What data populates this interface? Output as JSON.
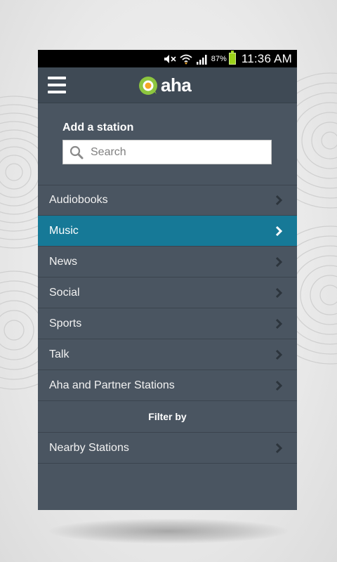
{
  "status_bar": {
    "battery_percent": "87%",
    "time": "11:36 AM",
    "icons": [
      "mute-icon",
      "wifi-icon",
      "signal-icon",
      "battery-icon"
    ]
  },
  "header": {
    "logo_text": "aha",
    "menu_icon": "hamburger-menu-icon"
  },
  "add_station": {
    "title": "Add a station",
    "search_placeholder": "Search"
  },
  "categories": [
    {
      "label": "Audiobooks",
      "selected": false
    },
    {
      "label": "Music",
      "selected": true
    },
    {
      "label": "News",
      "selected": false
    },
    {
      "label": "Social",
      "selected": false
    },
    {
      "label": "Sports",
      "selected": false
    },
    {
      "label": "Talk",
      "selected": false
    },
    {
      "label": "Aha and Partner Stations",
      "selected": false
    }
  ],
  "filter": {
    "header": "Filter by",
    "items": [
      {
        "label": "Nearby Stations"
      }
    ]
  },
  "colors": {
    "panel_bg": "#4a5561",
    "header_bg": "#3f4a55",
    "selected_bg": "#167997",
    "logo_accent": "#8dc63f",
    "logo_inner": "#f5a623"
  }
}
